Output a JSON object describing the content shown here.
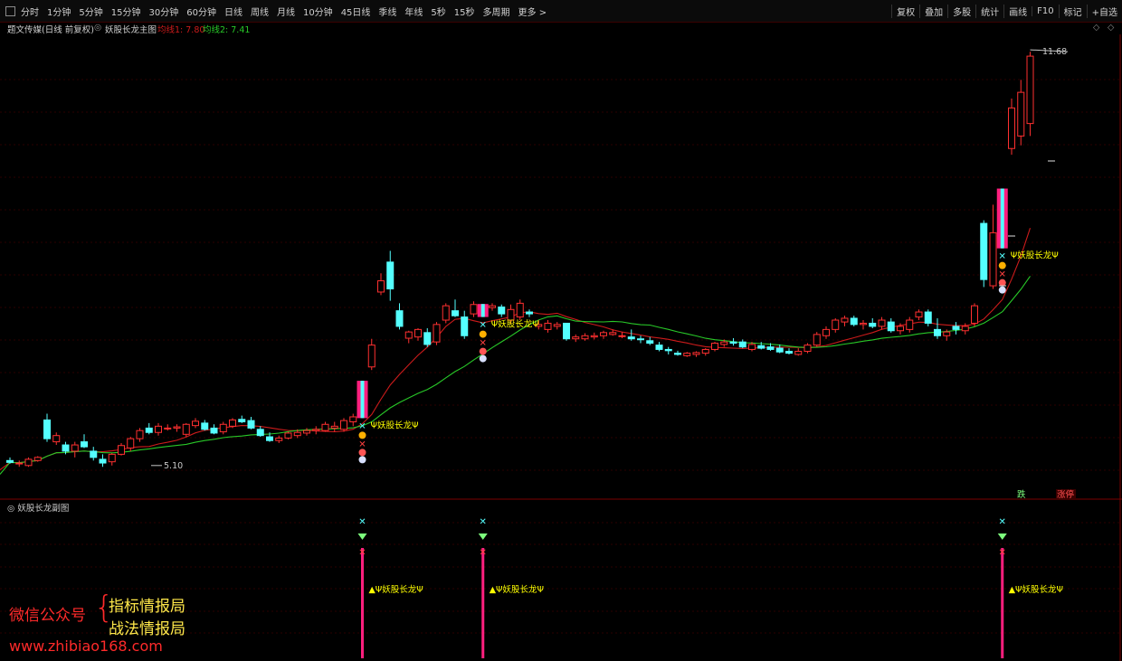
{
  "toolbar": {
    "periods": [
      "分时",
      "1分钟",
      "5分钟",
      "15分钟",
      "30分钟",
      "60分钟",
      "日线",
      "周线",
      "月线",
      "10分钟",
      "45日线",
      "季线",
      "年线",
      "5秒",
      "15秒",
      "多周期",
      "更多 >"
    ],
    "actions": [
      "复权",
      "叠加",
      "多股",
      "统计",
      "画线",
      "F10",
      "标记",
      "+自选"
    ]
  },
  "info": {
    "stock": "题文传媒(日线 前复权)",
    "indicator": "妖股长龙主图",
    "ma1": "均线1: 7.80",
    "ma2": "均线2: 7.41"
  },
  "colors": {
    "up": "#ff3030",
    "down": "#54ffff",
    "ma1": "#cc1b1b",
    "ma2": "#28c828",
    "signal_bar": "#ff1f7e",
    "signal_text": "#ffff00",
    "grid": "#2d0000"
  },
  "annotations": {
    "high_price": "11.68",
    "low_price": "5.10",
    "signal_label": "Ψ妖股长龙Ψ",
    "die": "跌",
    "zhangting": "涨停"
  },
  "sub_panel": {
    "title": "妖股长龙副图"
  },
  "watermark": {
    "label": "微信公众号",
    "line1": "指标情报局",
    "line2": "战法情报局",
    "url": "www.zhibiao168.com"
  },
  "chart_data": {
    "type": "candlestick",
    "price_range": [
      4.9,
      12.0
    ],
    "candles": [
      {
        "o": 5.2,
        "h": 5.25,
        "l": 5.15,
        "c": 5.17
      },
      {
        "o": 5.15,
        "h": 5.2,
        "l": 5.1,
        "c": 5.16
      },
      {
        "o": 5.12,
        "h": 5.25,
        "l": 5.1,
        "c": 5.22
      },
      {
        "o": 5.2,
        "h": 5.27,
        "l": 5.18,
        "c": 5.25
      },
      {
        "o": 5.85,
        "h": 5.95,
        "l": 5.5,
        "c": 5.55
      },
      {
        "o": 5.5,
        "h": 5.65,
        "l": 5.45,
        "c": 5.6
      },
      {
        "o": 5.45,
        "h": 5.5,
        "l": 5.3,
        "c": 5.35
      },
      {
        "o": 5.35,
        "h": 5.5,
        "l": 5.25,
        "c": 5.45
      },
      {
        "o": 5.5,
        "h": 5.62,
        "l": 5.4,
        "c": 5.42
      },
      {
        "o": 5.35,
        "h": 5.42,
        "l": 5.2,
        "c": 5.25
      },
      {
        "o": 5.22,
        "h": 5.3,
        "l": 5.1,
        "c": 5.16
      },
      {
        "o": 5.18,
        "h": 5.32,
        "l": 5.12,
        "c": 5.3
      },
      {
        "o": 5.3,
        "h": 5.48,
        "l": 5.28,
        "c": 5.44
      },
      {
        "o": 5.4,
        "h": 5.58,
        "l": 5.35,
        "c": 5.55
      },
      {
        "o": 5.55,
        "h": 5.72,
        "l": 5.5,
        "c": 5.68
      },
      {
        "o": 5.72,
        "h": 5.8,
        "l": 5.62,
        "c": 5.65
      },
      {
        "o": 5.65,
        "h": 5.8,
        "l": 5.6,
        "c": 5.75
      },
      {
        "o": 5.72,
        "h": 5.78,
        "l": 5.68,
        "c": 5.72
      },
      {
        "o": 5.72,
        "h": 5.78,
        "l": 5.66,
        "c": 5.74
      },
      {
        "o": 5.62,
        "h": 5.8,
        "l": 5.58,
        "c": 5.78
      },
      {
        "o": 5.76,
        "h": 5.88,
        "l": 5.72,
        "c": 5.83
      },
      {
        "o": 5.8,
        "h": 5.85,
        "l": 5.68,
        "c": 5.7
      },
      {
        "o": 5.72,
        "h": 5.78,
        "l": 5.62,
        "c": 5.64
      },
      {
        "o": 5.66,
        "h": 5.82,
        "l": 5.62,
        "c": 5.78
      },
      {
        "o": 5.75,
        "h": 5.88,
        "l": 5.72,
        "c": 5.85
      },
      {
        "o": 5.86,
        "h": 5.92,
        "l": 5.8,
        "c": 5.82
      },
      {
        "o": 5.84,
        "h": 5.9,
        "l": 5.7,
        "c": 5.72
      },
      {
        "o": 5.7,
        "h": 5.75,
        "l": 5.58,
        "c": 5.6
      },
      {
        "o": 5.58,
        "h": 5.65,
        "l": 5.5,
        "c": 5.52
      },
      {
        "o": 5.52,
        "h": 5.6,
        "l": 5.48,
        "c": 5.56
      },
      {
        "o": 5.56,
        "h": 5.66,
        "l": 5.54,
        "c": 5.64
      },
      {
        "o": 5.6,
        "h": 5.7,
        "l": 5.56,
        "c": 5.65
      },
      {
        "o": 5.64,
        "h": 5.72,
        "l": 5.6,
        "c": 5.68
      },
      {
        "o": 5.68,
        "h": 5.75,
        "l": 5.62,
        "c": 5.7
      },
      {
        "o": 5.68,
        "h": 5.82,
        "l": 5.66,
        "c": 5.78
      },
      {
        "o": 5.72,
        "h": 5.82,
        "l": 5.66,
        "c": 5.75
      },
      {
        "o": 5.7,
        "h": 5.88,
        "l": 5.66,
        "c": 5.84
      },
      {
        "o": 5.82,
        "h": 5.95,
        "l": 5.75,
        "c": 5.9
      },
      {
        "o": 5.9,
        "h": 6.42,
        "l": 5.88,
        "c": 6.39
      },
      {
        "o": 6.7,
        "h": 7.15,
        "l": 6.65,
        "c": 7.05
      },
      {
        "o": 7.9,
        "h": 8.2,
        "l": 7.85,
        "c": 8.08
      },
      {
        "o": 8.38,
        "h": 8.56,
        "l": 7.76,
        "c": 7.95
      },
      {
        "o": 7.6,
        "h": 7.72,
        "l": 7.3,
        "c": 7.35
      },
      {
        "o": 7.16,
        "h": 7.28,
        "l": 7.08,
        "c": 7.26
      },
      {
        "o": 7.18,
        "h": 7.32,
        "l": 7.12,
        "c": 7.3
      },
      {
        "o": 7.25,
        "h": 7.32,
        "l": 7.02,
        "c": 7.06
      },
      {
        "o": 7.1,
        "h": 7.42,
        "l": 7.05,
        "c": 7.38
      },
      {
        "o": 7.45,
        "h": 7.72,
        "l": 7.4,
        "c": 7.68
      },
      {
        "o": 7.6,
        "h": 7.78,
        "l": 7.5,
        "c": 7.52
      },
      {
        "o": 7.5,
        "h": 7.6,
        "l": 7.15,
        "c": 7.2
      },
      {
        "o": 7.55,
        "h": 7.75,
        "l": 7.5,
        "c": 7.7
      },
      {
        "o": 7.58,
        "h": 7.65,
        "l": 7.5,
        "c": 7.62
      },
      {
        "o": 7.65,
        "h": 7.72,
        "l": 7.6,
        "c": 7.68
      },
      {
        "o": 7.66,
        "h": 7.7,
        "l": 7.5,
        "c": 7.55
      },
      {
        "o": 7.45,
        "h": 7.7,
        "l": 7.4,
        "c": 7.62
      },
      {
        "o": 7.5,
        "h": 7.78,
        "l": 7.45,
        "c": 7.72
      },
      {
        "o": 7.58,
        "h": 7.62,
        "l": 7.5,
        "c": 7.55
      },
      {
        "o": 7.35,
        "h": 7.45,
        "l": 7.3,
        "c": 7.38
      },
      {
        "o": 7.3,
        "h": 7.45,
        "l": 7.25,
        "c": 7.4
      },
      {
        "o": 7.35,
        "h": 7.42,
        "l": 7.3,
        "c": 7.38
      },
      {
        "o": 7.4,
        "h": 7.22,
        "l": 7.12,
        "c": 7.15
      },
      {
        "o": 7.15,
        "h": 7.22,
        "l": 7.1,
        "c": 7.18
      },
      {
        "o": 7.15,
        "h": 7.24,
        "l": 7.12,
        "c": 7.2
      },
      {
        "o": 7.18,
        "h": 7.25,
        "l": 7.14,
        "c": 7.2
      },
      {
        "o": 7.2,
        "h": 7.28,
        "l": 7.15,
        "c": 7.25
      },
      {
        "o": 7.22,
        "h": 7.3,
        "l": 7.2,
        "c": 7.25
      },
      {
        "o": 7.2,
        "h": 7.26,
        "l": 7.16,
        "c": 7.2
      },
      {
        "o": 7.18,
        "h": 7.3,
        "l": 7.12,
        "c": 7.15
      },
      {
        "o": 7.15,
        "h": 7.2,
        "l": 7.08,
        "c": 7.14
      },
      {
        "o": 7.12,
        "h": 7.18,
        "l": 7.05,
        "c": 7.08
      },
      {
        "o": 7.05,
        "h": 7.1,
        "l": 6.95,
        "c": 6.98
      },
      {
        "o": 6.98,
        "h": 7.02,
        "l": 6.9,
        "c": 6.96
      },
      {
        "o": 6.92,
        "h": 6.96,
        "l": 6.88,
        "c": 6.9
      },
      {
        "o": 6.88,
        "h": 6.94,
        "l": 6.86,
        "c": 6.92
      },
      {
        "o": 6.9,
        "h": 6.95,
        "l": 6.86,
        "c": 6.93
      },
      {
        "o": 6.92,
        "h": 7.0,
        "l": 6.88,
        "c": 6.98
      },
      {
        "o": 6.98,
        "h": 7.1,
        "l": 6.95,
        "c": 7.08
      },
      {
        "o": 7.06,
        "h": 7.14,
        "l": 7.02,
        "c": 7.1
      },
      {
        "o": 7.1,
        "h": 7.16,
        "l": 7.04,
        "c": 7.08
      },
      {
        "o": 7.1,
        "h": 7.14,
        "l": 7.0,
        "c": 7.02
      },
      {
        "o": 6.98,
        "h": 7.1,
        "l": 6.95,
        "c": 7.06
      },
      {
        "o": 7.04,
        "h": 7.1,
        "l": 6.98,
        "c": 7.0
      },
      {
        "o": 7.02,
        "h": 7.08,
        "l": 6.96,
        "c": 6.98
      },
      {
        "o": 7.0,
        "h": 7.06,
        "l": 6.92,
        "c": 6.94
      },
      {
        "o": 6.95,
        "h": 7.0,
        "l": 6.9,
        "c": 6.92
      },
      {
        "o": 6.9,
        "h": 7.0,
        "l": 6.88,
        "c": 6.95
      },
      {
        "o": 6.95,
        "h": 7.08,
        "l": 6.92,
        "c": 7.05
      },
      {
        "o": 7.05,
        "h": 7.26,
        "l": 7.02,
        "c": 7.22
      },
      {
        "o": 7.2,
        "h": 7.35,
        "l": 7.15,
        "c": 7.3
      },
      {
        "o": 7.3,
        "h": 7.48,
        "l": 7.25,
        "c": 7.45
      },
      {
        "o": 7.42,
        "h": 7.52,
        "l": 7.35,
        "c": 7.48
      },
      {
        "o": 7.48,
        "h": 7.52,
        "l": 7.35,
        "c": 7.38
      },
      {
        "o": 7.38,
        "h": 7.45,
        "l": 7.3,
        "c": 7.4
      },
      {
        "o": 7.4,
        "h": 7.48,
        "l": 7.32,
        "c": 7.35
      },
      {
        "o": 7.35,
        "h": 7.5,
        "l": 7.3,
        "c": 7.45
      },
      {
        "o": 7.42,
        "h": 7.48,
        "l": 7.25,
        "c": 7.28
      },
      {
        "o": 7.28,
        "h": 7.4,
        "l": 7.22,
        "c": 7.35
      },
      {
        "o": 7.3,
        "h": 7.5,
        "l": 7.25,
        "c": 7.45
      },
      {
        "o": 7.5,
        "h": 7.62,
        "l": 7.45,
        "c": 7.58
      },
      {
        "o": 7.58,
        "h": 7.62,
        "l": 7.35,
        "c": 7.4
      },
      {
        "o": 7.3,
        "h": 7.48,
        "l": 7.15,
        "c": 7.2
      },
      {
        "o": 7.2,
        "h": 7.3,
        "l": 7.12,
        "c": 7.26
      },
      {
        "o": 7.35,
        "h": 7.42,
        "l": 7.22,
        "c": 7.3
      },
      {
        "o": 7.28,
        "h": 7.4,
        "l": 7.22,
        "c": 7.35
      },
      {
        "o": 7.4,
        "h": 7.72,
        "l": 7.35,
        "c": 7.68
      },
      {
        "o": 9.0,
        "h": 9.05,
        "l": 7.98,
        "c": 8.1
      },
      {
        "o": 8.0,
        "h": 9.3,
        "l": 7.95,
        "c": 8.85
      },
      {
        "o": 8.7,
        "h": 9.5,
        "l": 8.6,
        "c": 9.08
      },
      {
        "o": 10.2,
        "h": 11.0,
        "l": 10.1,
        "c": 10.85
      },
      {
        "o": 10.4,
        "h": 11.3,
        "l": 10.25,
        "c": 11.1
      },
      {
        "o": 10.6,
        "h": 11.75,
        "l": 10.4,
        "c": 11.68
      }
    ],
    "signals": [
      38,
      51,
      107
    ]
  }
}
